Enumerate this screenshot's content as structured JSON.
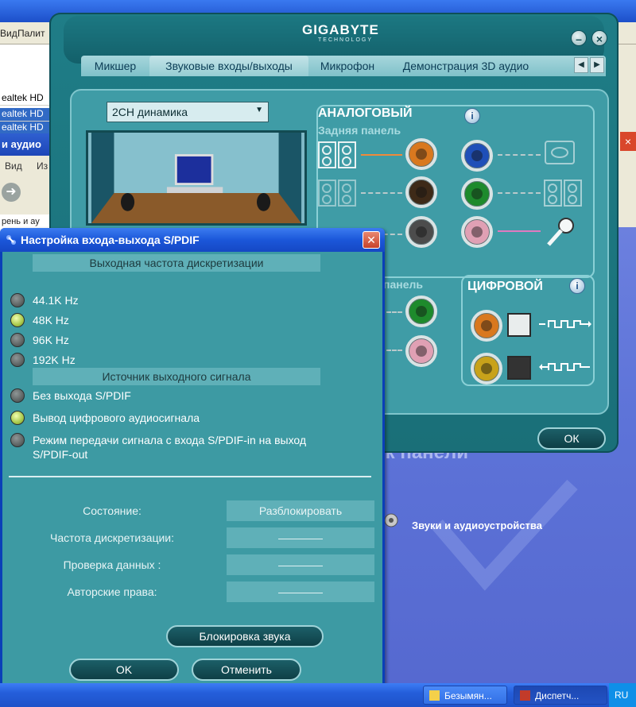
{
  "background": {
    "menu": [
      "Вид",
      "Палит"
    ],
    "tree_items": [
      "ealtek HD",
      "ealtek HD",
      "ealtek HD"
    ],
    "panel_title": "и аудио",
    "nav": [
      "Вид",
      "Из"
    ],
    "bottom_text": "рень и ау",
    "heading": "ок панели",
    "sound_link": "Звуки и аудиоустройства"
  },
  "taskbar": {
    "buttons": [
      {
        "label": "Безымян..."
      },
      {
        "label": "Диспетч..."
      }
    ],
    "tray": "RU"
  },
  "gigabyte": {
    "logo": "GIGABYTE",
    "sublogo": "TECHNOLOGY",
    "tabs": [
      "Микшер",
      "Звуковые входы/выходы",
      "Микрофон",
      "Демонстрация 3D аудио"
    ],
    "speaker_config": "2CH динамика",
    "analog_title": "АНАЛОГОВЫЙ",
    "rear_panel": "Задняя панель",
    "front_panel": "панель",
    "digital_title": "ЦИФРОВОЙ",
    "ok_label": "ОК",
    "colors": {
      "orange_jack": "#d9781f",
      "brown_jack": "#3e2a18",
      "gray_jack": "#4c4c4c",
      "blue_jack": "#1f4fb8",
      "green_jack": "#1e8a2c",
      "pink_jack": "#e0a0b4",
      "yellow_jack": "#c8a21a"
    }
  },
  "spdif": {
    "title": "Настройка входа-выхода S/PDIF",
    "rate_header": "Выходная частота дискретизации",
    "rates": [
      {
        "label": "44.1K Hz",
        "selected": false
      },
      {
        "label": "48K Hz",
        "selected": true
      },
      {
        "label": "96K Hz",
        "selected": false
      },
      {
        "label": "192K Hz",
        "selected": false
      }
    ],
    "source_header": "Источник выходного сигнала",
    "sources": [
      {
        "label": "Без выхода S/PDIF",
        "selected": false
      },
      {
        "label": "Вывод цифрового аудиосигнала",
        "selected": true
      },
      {
        "label": "Режим передачи сигнала с входа S/PDIF-in на выход",
        "label2": "S/PDIF-out",
        "selected": false
      }
    ],
    "info": [
      {
        "label": "Состояние:",
        "value": "Разблокировать"
      },
      {
        "label": "Частота дискретизации:",
        "value": "————"
      },
      {
        "label": "Проверка данных :",
        "value": "————"
      },
      {
        "label": "Авторские права:",
        "value": "————"
      }
    ],
    "mute_button": "Блокировка звука",
    "ok_button": "OK",
    "cancel_button": "Отменить"
  }
}
